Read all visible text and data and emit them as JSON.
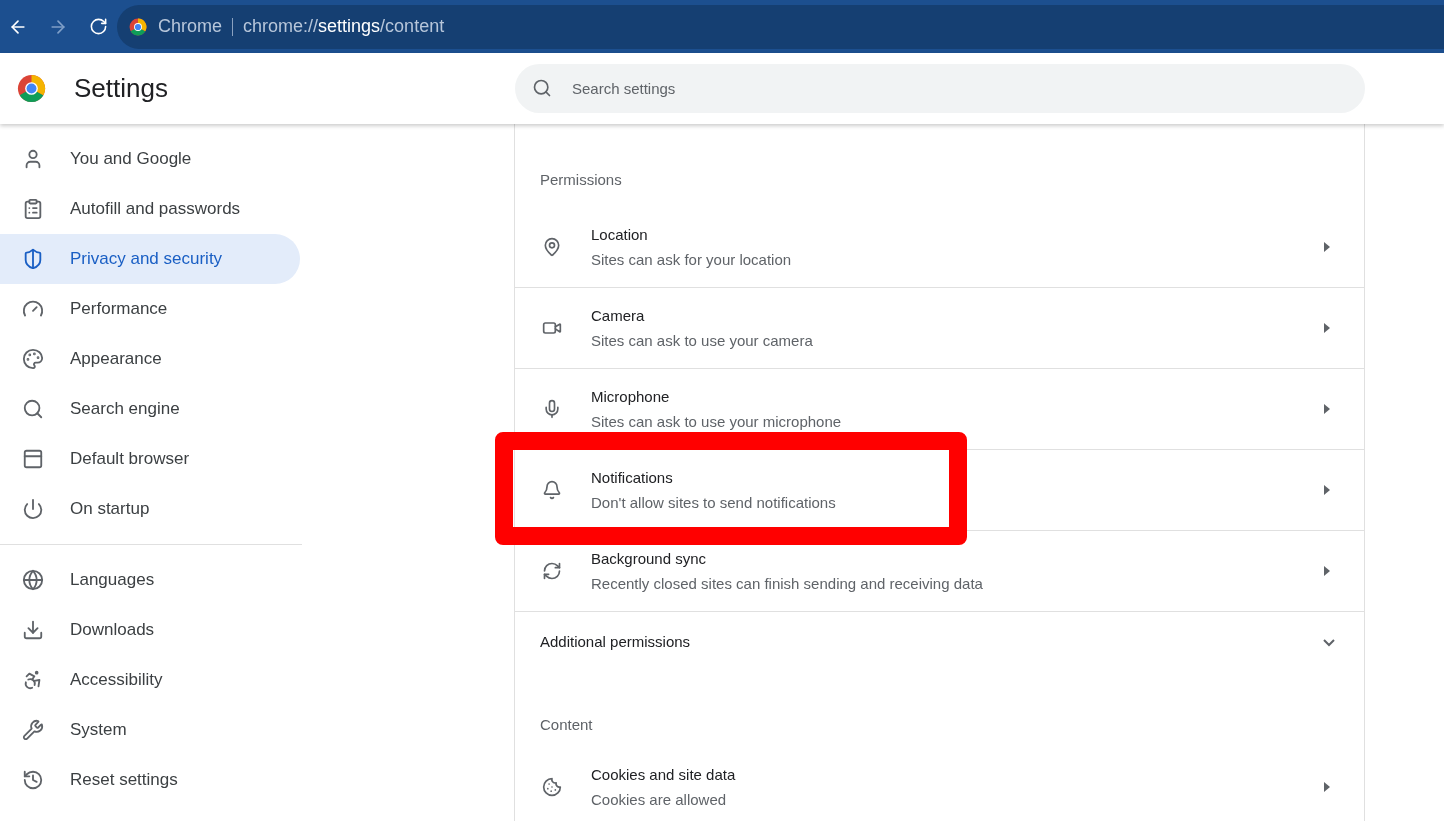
{
  "toolbar": {
    "site_label": "Chrome",
    "url": {
      "scheme": "chrome://",
      "host": "settings",
      "path": "/content"
    }
  },
  "header": {
    "title": "Settings",
    "search": {
      "placeholder": "Search settings"
    }
  },
  "sidebar": {
    "groups": [
      {
        "items": [
          {
            "label": "You and Google",
            "selected": false
          },
          {
            "label": "Autofill and passwords",
            "selected": false
          },
          {
            "label": "Privacy and security",
            "selected": true
          },
          {
            "label": "Performance",
            "selected": false
          },
          {
            "label": "Appearance",
            "selected": false
          },
          {
            "label": "Search engine",
            "selected": false
          },
          {
            "label": "Default browser",
            "selected": false
          },
          {
            "label": "On startup",
            "selected": false
          }
        ]
      },
      {
        "items": [
          {
            "label": "Languages",
            "selected": false
          },
          {
            "label": "Downloads",
            "selected": false
          },
          {
            "label": "Accessibility",
            "selected": false
          },
          {
            "label": "System",
            "selected": false
          },
          {
            "label": "Reset settings",
            "selected": false
          }
        ]
      }
    ]
  },
  "permissions": {
    "heading": "Permissions",
    "rows": [
      {
        "title": "Location",
        "subtitle": "Sites can ask for your location",
        "highlighted": false
      },
      {
        "title": "Camera",
        "subtitle": "Sites can ask to use your camera",
        "highlighted": false
      },
      {
        "title": "Microphone",
        "subtitle": "Sites can ask to use your microphone",
        "highlighted": false
      },
      {
        "title": "Notifications",
        "subtitle": "Don't allow sites to send notifications",
        "highlighted": true
      },
      {
        "title": "Background sync",
        "subtitle": "Recently closed sites can finish sending and receiving data",
        "highlighted": false
      }
    ],
    "additional": {
      "label": "Additional permissions",
      "expanded": false
    }
  },
  "content": {
    "heading": "Content",
    "rows": [
      {
        "title": "Cookies and site data",
        "subtitle": "Cookies are allowed"
      }
    ]
  }
}
